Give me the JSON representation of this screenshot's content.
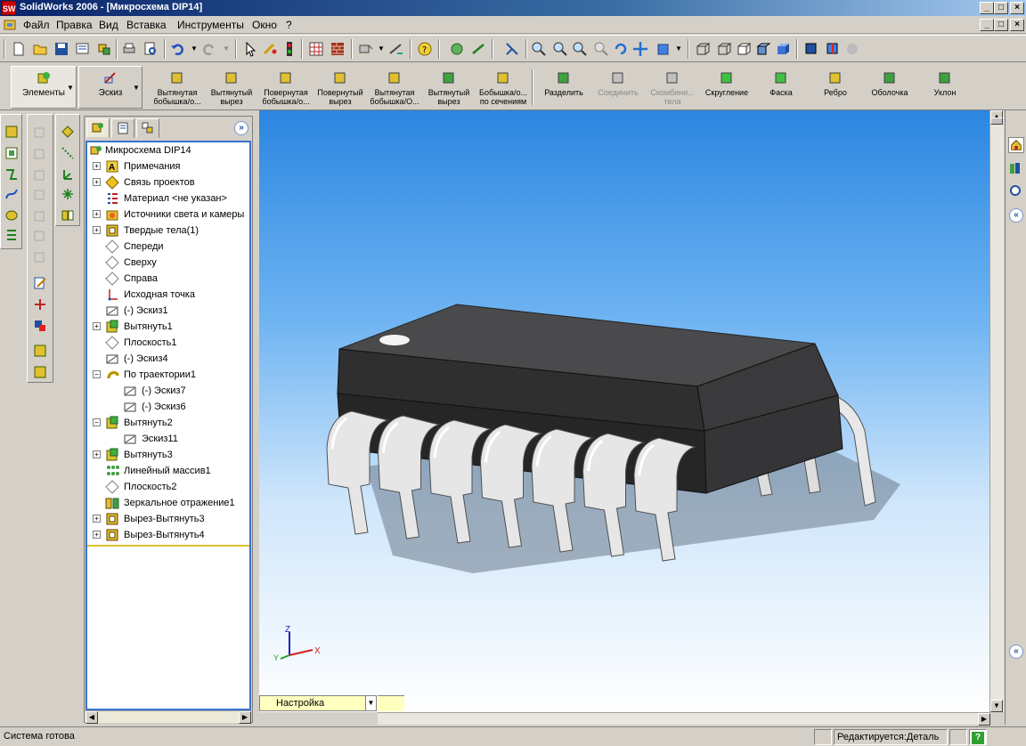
{
  "window": {
    "title": "SolidWorks 2006 - [Микросхема DIP14]",
    "app_icon": "SW"
  },
  "menu": {
    "items": [
      "Файл",
      "Правка",
      "Вид",
      "Вставка",
      "Инструменты",
      "Окно",
      "?"
    ]
  },
  "command_manager": {
    "tabs": {
      "features": "Элементы",
      "sketch": "Эскиз"
    },
    "items": [
      {
        "line1": "Вытянутая",
        "line2": "бобышка/о...",
        "enabled": true
      },
      {
        "line1": "Вытянутый",
        "line2": "вырез",
        "enabled": true
      },
      {
        "line1": "Повернутая",
        "line2": "бобышка/о...",
        "enabled": true
      },
      {
        "line1": "Повернутый",
        "line2": "вырез",
        "enabled": true
      },
      {
        "line1": "Вытянутая",
        "line2": "бобышка/О...",
        "enabled": true
      },
      {
        "line1": "Вытянутый",
        "line2": "вырез",
        "enabled": true
      },
      {
        "line1": "Бобышка/о...",
        "line2": "по сечениям",
        "enabled": true
      },
      {
        "line1": "Разделить",
        "line2": "",
        "enabled": true
      },
      {
        "line1": "Соединить",
        "line2": "",
        "enabled": false
      },
      {
        "line1": "Скомбини...",
        "line2": "тела",
        "enabled": false
      },
      {
        "line1": "Скругление",
        "line2": "",
        "enabled": true
      },
      {
        "line1": "Фаска",
        "line2": "",
        "enabled": true
      },
      {
        "line1": "Ребро",
        "line2": "",
        "enabled": true
      },
      {
        "line1": "Оболочка",
        "line2": "",
        "enabled": true
      },
      {
        "line1": "Уклон",
        "line2": "",
        "enabled": true
      }
    ]
  },
  "feature_tree": {
    "root": "Микросхема DIP14",
    "items": [
      {
        "label": "Примечания",
        "expand": "+",
        "icon": "annotations-icon",
        "indent": 0
      },
      {
        "label": "Связь проектов",
        "expand": "+",
        "icon": "design-binder-icon",
        "indent": 0
      },
      {
        "label": "Материал <не указан>",
        "expand": "",
        "icon": "material-icon",
        "indent": 0
      },
      {
        "label": "Источники света и камеры",
        "expand": "+",
        "icon": "lights-icon",
        "indent": 0
      },
      {
        "label": "Твердые тела(1)",
        "expand": "+",
        "icon": "solid-bodies-icon",
        "indent": 0
      },
      {
        "label": "Спереди",
        "expand": "",
        "icon": "plane-icon",
        "indent": 0
      },
      {
        "label": "Сверху",
        "expand": "",
        "icon": "plane-icon",
        "indent": 0
      },
      {
        "label": "Справа",
        "expand": "",
        "icon": "plane-icon",
        "indent": 0
      },
      {
        "label": "Исходная точка",
        "expand": "",
        "icon": "origin-icon",
        "indent": 0
      },
      {
        "label": "(-) Эскиз1",
        "expand": "",
        "icon": "sketch-icon",
        "indent": 0
      },
      {
        "label": "Вытянуть1",
        "expand": "+",
        "icon": "extrude-icon",
        "indent": 0
      },
      {
        "label": "Плоскость1",
        "expand": "",
        "icon": "plane-icon",
        "indent": 0
      },
      {
        "label": "(-) Эскиз4",
        "expand": "",
        "icon": "sketch-icon",
        "indent": 0
      },
      {
        "label": "По траектории1",
        "expand": "−",
        "icon": "sweep-icon",
        "indent": 0
      },
      {
        "label": "(-) Эскиз7",
        "expand": "",
        "icon": "sketch-icon",
        "indent": 1
      },
      {
        "label": "(-) Эскиз6",
        "expand": "",
        "icon": "sketch-icon",
        "indent": 1
      },
      {
        "label": "Вытянуть2",
        "expand": "−",
        "icon": "extrude-icon",
        "indent": 0
      },
      {
        "label": "Эскиз11",
        "expand": "",
        "icon": "sketch-icon",
        "indent": 1
      },
      {
        "label": "Вытянуть3",
        "expand": "+",
        "icon": "extrude-icon",
        "indent": 0
      },
      {
        "label": "Линейный массив1",
        "expand": "",
        "icon": "linear-pattern-icon",
        "indent": 0
      },
      {
        "label": "Плоскость2",
        "expand": "",
        "icon": "plane-icon",
        "indent": 0
      },
      {
        "label": "Зеркальное отражение1",
        "expand": "",
        "icon": "mirror-icon",
        "indent": 0
      },
      {
        "label": "Вырез-Вытянуть3",
        "expand": "+",
        "icon": "cut-extrude-icon",
        "indent": 0
      },
      {
        "label": "Вырез-Вытянуть4",
        "expand": "+",
        "icon": "cut-extrude-icon",
        "indent": 0
      }
    ]
  },
  "viewport": {
    "triad": {
      "x": "X",
      "y": "Y",
      "z": "Z"
    },
    "config_name": "Настройка"
  },
  "status": {
    "left": "Система готова",
    "mode": "Редактируется:Деталь",
    "help": "?"
  },
  "colors": {
    "accent": "#0a246a",
    "tree_border": "#3a73c9",
    "chip_body": "#2f2f30"
  }
}
